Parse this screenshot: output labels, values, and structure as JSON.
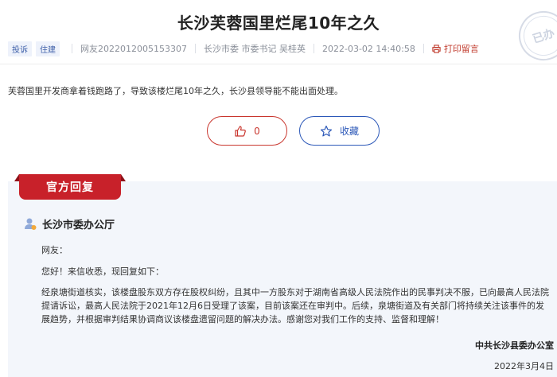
{
  "page": {
    "title": "长沙芙蓉国里烂尾10年之久",
    "stamp": "已办"
  },
  "meta": {
    "tags": [
      "投诉",
      "住建"
    ],
    "user": "网友2022012005153307",
    "target": "长沙市委 市委书记 吴桂英",
    "time": "2022-03-02 14:40:58",
    "print_label": "打印留言"
  },
  "message": {
    "content": "芙蓉国里开发商拿着钱跑路了，导致该楼烂尾10年之久，长沙县领导能不能出面处理。"
  },
  "actions": {
    "like_count": "0",
    "favorite_label": "收藏"
  },
  "reply": {
    "header": "官方回复",
    "office": "长沙市委办公厅",
    "greeting": "网友：",
    "opening": "您好！来信收悉，现回复如下：",
    "body": "经泉塘街道核实，该楼盘股东双方存在股权纠纷，且其中一方股东对于湖南省高级人民法院作出的民事判决不服，已向最高人民法院提请诉讼，最高人民法院于2021年12月6日受理了该案，目前该案还在审判中。后续，泉塘街道及有关部门将持续关注该事件的发展趋势，并根据审判结果协调商议该楼盘遗留问题的解决办法。感谢您对我们工作的支持、监督和理解！",
    "signature": "中共长沙县委办公室",
    "date": "2022年3月4日"
  },
  "colors": {
    "accent_red": "#c8212a",
    "accent_blue": "#2c58b8"
  }
}
